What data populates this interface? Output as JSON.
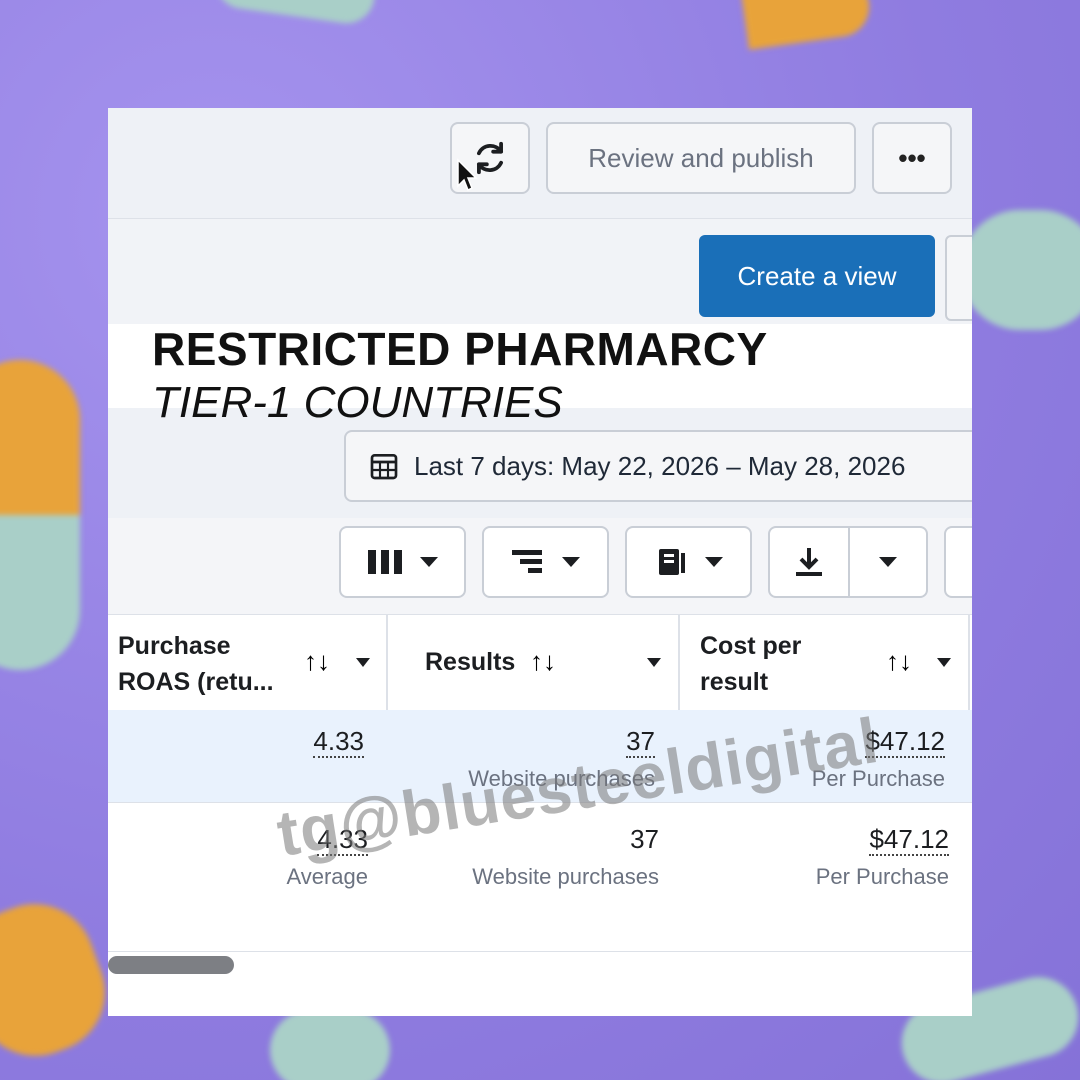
{
  "toolbar": {
    "review_label": "Review and publish",
    "more_label": "•••"
  },
  "views": {
    "create_label": "Create a view"
  },
  "overlay": {
    "title": "RESTRICTED PHARMARCY",
    "subtitle": "TIER-1 COUNTRIES"
  },
  "date_range": {
    "label": "Last 7 days: May 22, 2026 – May 28, 2026"
  },
  "table": {
    "columns": [
      {
        "label_line1": "Purchase",
        "label_line2": "ROAS (retu..."
      },
      {
        "label": "Results"
      },
      {
        "label_line1": "Cost per",
        "label_line2": "result"
      }
    ],
    "sort_glyph": "↑↓",
    "rows": [
      {
        "roas": "4.33",
        "results": "37",
        "results_sub": "Website purchases",
        "cost": "$47.12",
        "cost_sub": "Per Purchase"
      },
      {
        "roas": "4.33",
        "roas_sub": "Average",
        "results": "37",
        "results_sub": "Website purchases",
        "cost": "$47.12",
        "cost_sub": "Per Purchase"
      }
    ]
  },
  "watermark": "tg@bluesteeldigital",
  "colors": {
    "primary": "#1a6fb8",
    "row_highlight": "#e9f2fd",
    "background": "#9b8ae6"
  }
}
